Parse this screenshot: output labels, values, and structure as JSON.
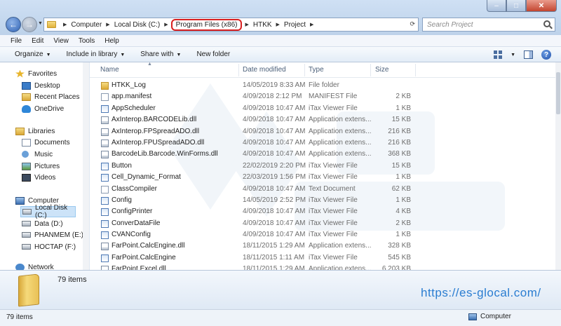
{
  "window": {
    "min_glyph": "–",
    "max_glyph": "□",
    "close_glyph": "✕"
  },
  "address": {
    "crumbs": [
      "Computer",
      "Local Disk (C:)",
      "Program Files (x86)",
      "HTKK",
      "Project"
    ],
    "highlighted_crumb": "Program Files (x86)",
    "search_placeholder": "Search Project"
  },
  "menu": [
    "File",
    "Edit",
    "View",
    "Tools",
    "Help"
  ],
  "toolbar": {
    "organize": "Organize",
    "include": "Include in library",
    "share": "Share with",
    "new_folder": "New folder"
  },
  "sidebar": {
    "favorites": "Favorites",
    "desktop": "Desktop",
    "recent": "Recent Places",
    "onedrive": "OneDrive",
    "libraries": "Libraries",
    "documents": "Documents",
    "music": "Music",
    "pictures": "Pictures",
    "videos": "Videos",
    "computer": "Computer",
    "local_disk": "Local Disk (C:)",
    "data": "Data (D:)",
    "phanmem": "PHANMEM (E:)",
    "hoctap": "HOCTAP (F:)",
    "network": "Network"
  },
  "columns": {
    "name": "Name",
    "date": "Date modified",
    "type": "Type",
    "size": "Size"
  },
  "files": [
    {
      "name": "HTKK_Log",
      "date": "14/05/2019 8:33 AM",
      "type": "File folder",
      "size": "",
      "icon": "folder"
    },
    {
      "name": "app.manifest",
      "date": "4/09/2018 2:12 PM",
      "type": "MANIFEST File",
      "size": "2 KB",
      "icon": "file"
    },
    {
      "name": "AppScheduler",
      "date": "4/09/2018 10:47 AM",
      "type": "iTax Viewer File",
      "size": "1 KB",
      "icon": "itax"
    },
    {
      "name": "AxInterop.BARCODELib.dll",
      "date": "4/09/2018 10:47 AM",
      "type": "Application extens...",
      "size": "15 KB",
      "icon": "dll"
    },
    {
      "name": "AxInterop.FPSpreadADO.dll",
      "date": "4/09/2018 10:47 AM",
      "type": "Application extens...",
      "size": "216 KB",
      "icon": "dll"
    },
    {
      "name": "AxInterop.FPUSpreadADO.dll",
      "date": "4/09/2018 10:47 AM",
      "type": "Application extens...",
      "size": "216 KB",
      "icon": "dll"
    },
    {
      "name": "BarcodeLib.Barcode.WinForms.dll",
      "date": "4/09/2018 10:47 AM",
      "type": "Application extens...",
      "size": "368 KB",
      "icon": "dll"
    },
    {
      "name": "Button",
      "date": "22/02/2019 2:20 PM",
      "type": "iTax Viewer File",
      "size": "15 KB",
      "icon": "itax"
    },
    {
      "name": "Cell_Dynamic_Format",
      "date": "22/03/2019 1:56 PM",
      "type": "iTax Viewer File",
      "size": "1 KB",
      "icon": "itax"
    },
    {
      "name": "ClassCompiler",
      "date": "4/09/2018 10:47 AM",
      "type": "Text Document",
      "size": "62 KB",
      "icon": "file"
    },
    {
      "name": "Config",
      "date": "14/05/2019 2:52 PM",
      "type": "iTax Viewer File",
      "size": "1 KB",
      "icon": "itax"
    },
    {
      "name": "ConfigPrinter",
      "date": "4/09/2018 10:47 AM",
      "type": "iTax Viewer File",
      "size": "4 KB",
      "icon": "itax"
    },
    {
      "name": "ConverDataFile",
      "date": "4/09/2018 10:47 AM",
      "type": "iTax Viewer File",
      "size": "2 KB",
      "icon": "itax"
    },
    {
      "name": "CVANConfig",
      "date": "4/09/2018 10:47 AM",
      "type": "iTax Viewer File",
      "size": "1 KB",
      "icon": "itax"
    },
    {
      "name": "FarPoint.CalcEngine.dll",
      "date": "18/11/2015 1:29 AM",
      "type": "Application extens...",
      "size": "328 KB",
      "icon": "dll"
    },
    {
      "name": "FarPoint.CalcEngine",
      "date": "18/11/2015 1:11 AM",
      "type": "iTax Viewer File",
      "size": "545 KB",
      "icon": "itax"
    },
    {
      "name": "FarPoint.Excel.dll",
      "date": "18/11/2015 1:29 AM",
      "type": "Application extens...",
      "size": "6,203 KB",
      "icon": "dll"
    }
  ],
  "details": {
    "count": "79 items",
    "site": "https://es-glocal.com/"
  },
  "status": {
    "count": "79 items",
    "location": "Computer"
  }
}
